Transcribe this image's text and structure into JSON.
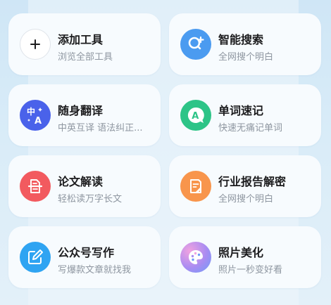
{
  "cards": [
    {
      "title": "添加工具",
      "subtitle": "浏览全部工具",
      "icon": "plus-icon"
    },
    {
      "title": "智能搜索",
      "subtitle": "全网搜个明白",
      "icon": "search-plus-icon"
    },
    {
      "title": "随身翻译",
      "subtitle": "中英互译 语法纠正...",
      "icon": "translate-icon"
    },
    {
      "title": "单词速记",
      "subtitle": "快速无痛记单词",
      "icon": "vocabulary-icon"
    },
    {
      "title": "论文解读",
      "subtitle": "轻松读万字长文",
      "icon": "document-scan-icon"
    },
    {
      "title": "行业报告解密",
      "subtitle": "全网搜个明白",
      "icon": "report-icon"
    },
    {
      "title": "公众号写作",
      "subtitle": "写爆款文章就找我",
      "icon": "edit-icon"
    },
    {
      "title": "照片美化",
      "subtitle": "照片一秒变好看",
      "icon": "palette-icon"
    }
  ],
  "icon_glyphs": {
    "translate_top": "中",
    "translate_bottom": "A",
    "vocabulary": "A"
  },
  "colors": {
    "search": "#4b9bf0",
    "translate": "#4a62ea",
    "vocabulary": "#2dc487",
    "paper": "#f25a5f",
    "report": "#f8954c",
    "write": "#2fa4f2",
    "photo": "#a98cf2"
  }
}
